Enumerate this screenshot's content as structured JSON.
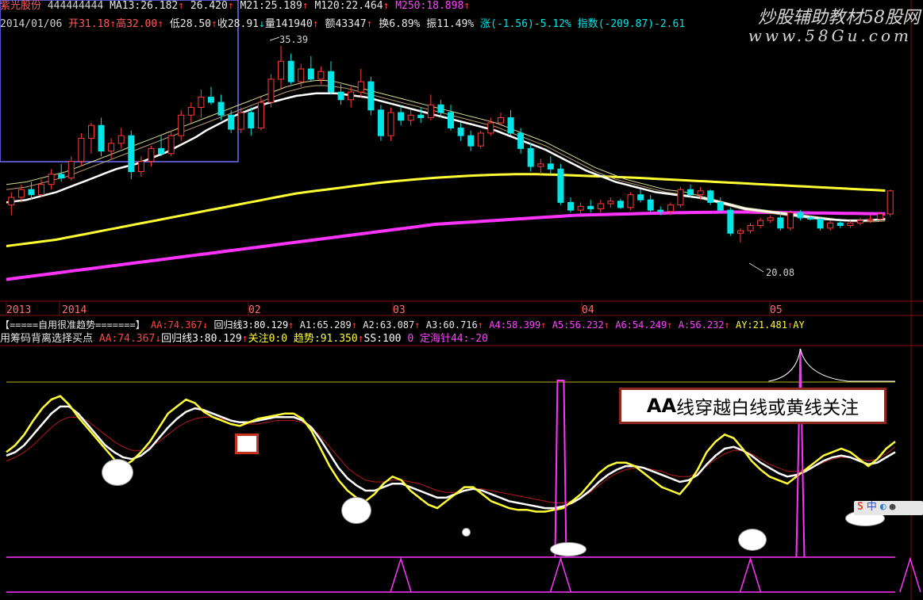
{
  "stock": {
    "name": "紫光股份",
    "code": "444444444",
    "ma13": "MA13:26.182",
    "ma13_val": "26.420",
    "ma21": "M21:25.189",
    "ma120": "M120:22.464",
    "ma250": "M250:18.898"
  },
  "info": {
    "date": "2014/01/06",
    "open": "开31.18",
    "high": "高32.00",
    "low": "低28.50",
    "close": "收28.91",
    "volume": "量141940",
    "amount": "额43347",
    "turnover": "换6.89%",
    "amplitude": "振11.49%",
    "change": "涨(-1.56)-5.12%",
    "index": "指数(-209.87)-2.61"
  },
  "watermark": {
    "line1": "炒股辅助教材58股网",
    "line2": "www.58Gu.com"
  },
  "labels": {
    "high_label": "35.39",
    "low_label": "20.08"
  },
  "time_axis": [
    "2013",
    "2014",
    "02",
    "03",
    "04",
    "05"
  ],
  "indicator1": {
    "name": "【=====自用很准趋势=======】",
    "aa": "AA:74.367",
    "huigui": "回归线3:80.129",
    "a1": "A1:65.289",
    "a2": "A2:63.087",
    "a3": "A3:60.716",
    "a4": "A4:58.399",
    "a5": "A5:56.232",
    "a6": "A6:54.249",
    "a": "A:56.232",
    "ay": "AY:21.481",
    "ay_tail": "AY"
  },
  "indicator2": {
    "name": "用筹码背离选择买点",
    "aa": "AA:74.367",
    "huigui": "回归线3:80.129",
    "guanzhu": "关注0:0",
    "qushi": "趋势:91.350",
    "ss": "SS:100",
    "zero": "0",
    "dinghai": "定海针44:-20"
  },
  "annotation": {
    "bold": "AA",
    "text": "线穿越白线或黄线关注"
  },
  "colors": {
    "up": "#ff3b3b",
    "down": "#00e5e5",
    "ma_white": "#ffffff",
    "ma_yellow": "#ffff33",
    "ma_magenta": "#ff33ff",
    "ma_thin": "#d8d890",
    "frame": "#7a0e0e"
  },
  "chart_data": {
    "type": "candlestick",
    "x_labels": [
      "2013",
      "2014",
      "02",
      "03",
      "04",
      "05"
    ],
    "candles": [
      {
        "o": 23.0,
        "h": 24.0,
        "l": 22.2,
        "c": 23.6
      },
      {
        "o": 23.6,
        "h": 24.6,
        "l": 23.2,
        "c": 24.2
      },
      {
        "o": 24.2,
        "h": 24.8,
        "l": 23.4,
        "c": 23.8
      },
      {
        "o": 23.8,
        "h": 25.0,
        "l": 23.6,
        "c": 24.6
      },
      {
        "o": 24.6,
        "h": 25.8,
        "l": 24.2,
        "c": 25.4
      },
      {
        "o": 25.4,
        "h": 26.2,
        "l": 24.8,
        "c": 25.1
      },
      {
        "o": 25.1,
        "h": 26.8,
        "l": 24.9,
        "c": 26.4
      },
      {
        "o": 26.4,
        "h": 28.6,
        "l": 26.0,
        "c": 28.2
      },
      {
        "o": 28.2,
        "h": 29.4,
        "l": 27.0,
        "c": 29.2
      },
      {
        "o": 29.2,
        "h": 29.8,
        "l": 26.8,
        "c": 27.2
      },
      {
        "o": 27.2,
        "h": 28.2,
        "l": 26.6,
        "c": 27.8
      },
      {
        "o": 27.8,
        "h": 29.0,
        "l": 27.4,
        "c": 28.4
      },
      {
        "o": 28.4,
        "h": 28.8,
        "l": 25.0,
        "c": 25.6
      },
      {
        "o": 25.6,
        "h": 26.8,
        "l": 25.2,
        "c": 26.4
      },
      {
        "o": 26.4,
        "h": 27.6,
        "l": 26.0,
        "c": 27.4
      },
      {
        "o": 27.4,
        "h": 28.4,
        "l": 26.8,
        "c": 27.0
      },
      {
        "o": 27.0,
        "h": 28.8,
        "l": 26.8,
        "c": 28.4
      },
      {
        "o": 28.4,
        "h": 30.4,
        "l": 28.0,
        "c": 30.0
      },
      {
        "o": 30.0,
        "h": 31.0,
        "l": 29.4,
        "c": 30.6
      },
      {
        "o": 30.6,
        "h": 32.0,
        "l": 29.8,
        "c": 31.4
      },
      {
        "o": 31.4,
        "h": 32.2,
        "l": 30.8,
        "c": 31.0
      },
      {
        "o": 31.0,
        "h": 31.6,
        "l": 29.6,
        "c": 30.0
      },
      {
        "o": 30.0,
        "h": 30.4,
        "l": 28.6,
        "c": 28.9
      },
      {
        "o": 28.9,
        "h": 30.6,
        "l": 28.6,
        "c": 30.2
      },
      {
        "o": 30.2,
        "h": 30.6,
        "l": 28.4,
        "c": 29.0
      },
      {
        "o": 29.0,
        "h": 31.4,
        "l": 28.8,
        "c": 31.0
      },
      {
        "o": 31.0,
        "h": 33.2,
        "l": 30.6,
        "c": 32.8
      },
      {
        "o": 32.8,
        "h": 35.39,
        "l": 32.0,
        "c": 34.2
      },
      {
        "o": 34.2,
        "h": 34.8,
        "l": 32.4,
        "c": 32.6
      },
      {
        "o": 32.6,
        "h": 34.0,
        "l": 32.2,
        "c": 33.6
      },
      {
        "o": 33.6,
        "h": 34.6,
        "l": 32.6,
        "c": 32.8
      },
      {
        "o": 32.8,
        "h": 33.8,
        "l": 32.4,
        "c": 33.4
      },
      {
        "o": 33.4,
        "h": 34.2,
        "l": 31.6,
        "c": 31.8
      },
      {
        "o": 31.8,
        "h": 32.4,
        "l": 30.8,
        "c": 31.2
      },
      {
        "o": 31.2,
        "h": 32.2,
        "l": 30.6,
        "c": 31.8
      },
      {
        "o": 31.8,
        "h": 33.6,
        "l": 31.4,
        "c": 32.6
      },
      {
        "o": 32.6,
        "h": 33.0,
        "l": 30.0,
        "c": 30.4
      },
      {
        "o": 30.4,
        "h": 30.8,
        "l": 28.0,
        "c": 28.4
      },
      {
        "o": 28.4,
        "h": 30.6,
        "l": 28.0,
        "c": 30.2
      },
      {
        "o": 30.2,
        "h": 30.8,
        "l": 29.2,
        "c": 29.6
      },
      {
        "o": 29.6,
        "h": 30.4,
        "l": 29.2,
        "c": 30.0
      },
      {
        "o": 30.0,
        "h": 30.6,
        "l": 29.4,
        "c": 29.8
      },
      {
        "o": 29.8,
        "h": 31.6,
        "l": 29.6,
        "c": 30.8
      },
      {
        "o": 30.8,
        "h": 31.2,
        "l": 29.8,
        "c": 30.2
      },
      {
        "o": 30.2,
        "h": 30.8,
        "l": 28.8,
        "c": 29.0
      },
      {
        "o": 29.0,
        "h": 29.4,
        "l": 28.0,
        "c": 28.4
      },
      {
        "o": 28.4,
        "h": 28.8,
        "l": 27.2,
        "c": 27.6
      },
      {
        "o": 27.6,
        "h": 28.8,
        "l": 27.4,
        "c": 28.6
      },
      {
        "o": 28.6,
        "h": 29.8,
        "l": 28.4,
        "c": 29.4
      },
      {
        "o": 29.4,
        "h": 30.2,
        "l": 29.2,
        "c": 29.8
      },
      {
        "o": 29.8,
        "h": 30.4,
        "l": 28.4,
        "c": 28.6
      },
      {
        "o": 28.6,
        "h": 29.0,
        "l": 27.0,
        "c": 27.4
      },
      {
        "o": 27.4,
        "h": 27.8,
        "l": 25.6,
        "c": 26.0
      },
      {
        "o": 26.0,
        "h": 26.6,
        "l": 25.4,
        "c": 26.2
      },
      {
        "o": 26.2,
        "h": 26.8,
        "l": 25.4,
        "c": 25.8
      },
      {
        "o": 25.8,
        "h": 26.2,
        "l": 23.0,
        "c": 23.2
      },
      {
        "o": 23.2,
        "h": 23.6,
        "l": 22.4,
        "c": 22.6
      },
      {
        "o": 22.6,
        "h": 23.2,
        "l": 22.2,
        "c": 22.9
      },
      {
        "o": 22.9,
        "h": 23.4,
        "l": 22.4,
        "c": 22.7
      },
      {
        "o": 22.7,
        "h": 23.4,
        "l": 22.4,
        "c": 23.1
      },
      {
        "o": 23.1,
        "h": 23.6,
        "l": 22.8,
        "c": 23.3
      },
      {
        "o": 23.3,
        "h": 23.5,
        "l": 22.7,
        "c": 22.8
      },
      {
        "o": 22.8,
        "h": 24.0,
        "l": 22.6,
        "c": 23.8
      },
      {
        "o": 23.8,
        "h": 24.2,
        "l": 23.2,
        "c": 23.4
      },
      {
        "o": 23.4,
        "h": 23.8,
        "l": 22.4,
        "c": 22.6
      },
      {
        "o": 22.6,
        "h": 22.9,
        "l": 22.2,
        "c": 22.5
      },
      {
        "o": 22.5,
        "h": 23.2,
        "l": 22.2,
        "c": 23.0
      },
      {
        "o": 23.0,
        "h": 24.4,
        "l": 22.8,
        "c": 24.2
      },
      {
        "o": 24.2,
        "h": 24.6,
        "l": 23.6,
        "c": 23.8
      },
      {
        "o": 23.8,
        "h": 24.4,
        "l": 23.4,
        "c": 24.1
      },
      {
        "o": 24.1,
        "h": 24.2,
        "l": 23.0,
        "c": 23.2
      },
      {
        "o": 23.2,
        "h": 23.6,
        "l": 22.4,
        "c": 22.6
      },
      {
        "o": 22.6,
        "h": 22.8,
        "l": 20.6,
        "c": 20.8
      },
      {
        "o": 20.8,
        "h": 21.2,
        "l": 20.08,
        "c": 21.0
      },
      {
        "o": 21.0,
        "h": 21.6,
        "l": 20.8,
        "c": 21.4
      },
      {
        "o": 21.4,
        "h": 22.0,
        "l": 21.2,
        "c": 21.8
      },
      {
        "o": 21.8,
        "h": 22.2,
        "l": 21.6,
        "c": 22.0
      },
      {
        "o": 22.0,
        "h": 22.4,
        "l": 21.0,
        "c": 21.2
      },
      {
        "o": 21.2,
        "h": 22.6,
        "l": 21.0,
        "c": 22.4
      },
      {
        "o": 22.4,
        "h": 22.6,
        "l": 21.8,
        "c": 22.0
      },
      {
        "o": 22.0,
        "h": 22.2,
        "l": 21.8,
        "c": 21.9
      },
      {
        "o": 21.9,
        "h": 22.0,
        "l": 21.0,
        "c": 21.2
      },
      {
        "o": 21.2,
        "h": 21.8,
        "l": 21.0,
        "c": 21.6
      },
      {
        "o": 21.6,
        "h": 21.8,
        "l": 21.2,
        "c": 21.4
      },
      {
        "o": 21.4,
        "h": 21.8,
        "l": 21.2,
        "c": 21.6
      },
      {
        "o": 21.6,
        "h": 22.0,
        "l": 21.4,
        "c": 21.8
      },
      {
        "o": 21.8,
        "h": 22.2,
        "l": 21.6,
        "c": 21.9
      },
      {
        "o": 21.9,
        "h": 22.4,
        "l": 21.7,
        "c": 22.3
      },
      {
        "o": 22.3,
        "h": 24.2,
        "l": 22.1,
        "c": 24.1
      }
    ],
    "ma_white": [
      23.2,
      23.3,
      23.4,
      23.6,
      23.8,
      24.0,
      24.3,
      24.6,
      24.9,
      25.2,
      25.5,
      25.8,
      26.0,
      26.2,
      26.5,
      26.8,
      27.1,
      27.5,
      27.9,
      28.3,
      28.8,
      29.2,
      29.6,
      30.0,
      30.3,
      30.6,
      30.9,
      31.1,
      31.3,
      31.5,
      31.6,
      31.7,
      31.7,
      31.7,
      31.6,
      31.5,
      31.4,
      31.2,
      31.0,
      30.8,
      30.6,
      30.4,
      30.2,
      30.0,
      29.8,
      29.6,
      29.4,
      29.2,
      29.0,
      28.8,
      28.5,
      28.2,
      27.9,
      27.6,
      27.3,
      26.9,
      26.5,
      26.1,
      25.7,
      25.4,
      25.1,
      24.8,
      24.6,
      24.4,
      24.2,
      24.0,
      23.9,
      23.8,
      23.7,
      23.6,
      23.5,
      23.3,
      23.1,
      22.9,
      22.7,
      22.6,
      22.5,
      22.4,
      22.3,
      22.2,
      22.1,
      22.0,
      21.9,
      21.85,
      21.8,
      21.8,
      21.8,
      21.85,
      21.9
    ],
    "ma_thin1": [
      24.2,
      24.3,
      24.4,
      24.6,
      24.8,
      25.0,
      25.2,
      25.5,
      25.8,
      26.1,
      26.4,
      26.7,
      27.0,
      27.3,
      27.6,
      27.9,
      28.2,
      28.5,
      28.8,
      29.1,
      29.4,
      29.7,
      30.0,
      30.3,
      30.6,
      30.9,
      31.2,
      31.5,
      31.8,
      32.0,
      32.2,
      32.3,
      32.3,
      32.2,
      32.1,
      31.9,
      31.7,
      31.5,
      31.3,
      31.1,
      30.9,
      30.7,
      30.5,
      30.3,
      30.1,
      29.9,
      29.7,
      29.5,
      29.3,
      29.1,
      28.8,
      28.5,
      28.2,
      27.9,
      27.6,
      27.2,
      26.8,
      26.4,
      26.0,
      25.6,
      25.3,
      25.0,
      24.8,
      24.6,
      24.4,
      24.2,
      24.0,
      23.9,
      23.8,
      23.6,
      23.4,
      23.2,
      23.0,
      22.8,
      22.6,
      22.5,
      22.4,
      22.3,
      22.2,
      22.1,
      22.0,
      21.9,
      21.85,
      21.8,
      21.75,
      21.7,
      21.7,
      21.7,
      21.75
    ],
    "ma_thin2": [
      24.6,
      24.7,
      24.8,
      25.0,
      25.2,
      25.4,
      25.6,
      25.9,
      26.2,
      26.5,
      26.8,
      27.1,
      27.4,
      27.7,
      28.0,
      28.3,
      28.6,
      28.9,
      29.2,
      29.5,
      29.8,
      30.1,
      30.4,
      30.7,
      31.0,
      31.3,
      31.6,
      31.9,
      32.2,
      32.4,
      32.6,
      32.7,
      32.7,
      32.6,
      32.4,
      32.2,
      32.0,
      31.8,
      31.6,
      31.4,
      31.2,
      31.0,
      30.8,
      30.6,
      30.4,
      30.2,
      30.0,
      29.8,
      29.6,
      29.4,
      29.1,
      28.8,
      28.5,
      28.2,
      27.9,
      27.5,
      27.1,
      26.7,
      26.3,
      25.9,
      25.6,
      25.3,
      25.0,
      24.8,
      24.6,
      24.4,
      24.2,
      24.1,
      24.0,
      23.8,
      23.6,
      23.4,
      23.2,
      23.0,
      22.8,
      22.7,
      22.6,
      22.5,
      22.4,
      22.3,
      22.2,
      22.1,
      22.0,
      21.9,
      21.85,
      21.8,
      21.8,
      21.8,
      21.85
    ],
    "ma_yellow": [
      19.8,
      19.9,
      20.0,
      20.1,
      20.2,
      20.3,
      20.45,
      20.6,
      20.75,
      20.9,
      21.05,
      21.2,
      21.35,
      21.5,
      21.65,
      21.8,
      21.95,
      22.1,
      22.25,
      22.4,
      22.55,
      22.7,
      22.85,
      23.0,
      23.15,
      23.3,
      23.45,
      23.6,
      23.75,
      23.9,
      24.0,
      24.1,
      24.2,
      24.3,
      24.4,
      24.5,
      24.6,
      24.7,
      24.78,
      24.86,
      24.93,
      25.0,
      25.06,
      25.12,
      25.17,
      25.22,
      25.26,
      25.3,
      25.33,
      25.36,
      25.38,
      25.4,
      25.4,
      25.4,
      25.38,
      25.36,
      25.33,
      25.3,
      25.27,
      25.24,
      25.21,
      25.18,
      25.15,
      25.12,
      25.08,
      25.04,
      25.0,
      24.96,
      24.92,
      24.88,
      24.84,
      24.8,
      24.76,
      24.72,
      24.68,
      24.64,
      24.6,
      24.56,
      24.52,
      24.48,
      24.44,
      24.4,
      24.36,
      24.32,
      24.28,
      24.24,
      24.2,
      24.16,
      24.12
    ],
    "ma_magenta": [
      17.2,
      17.3,
      17.4,
      17.5,
      17.6,
      17.7,
      17.8,
      17.9,
      18.0,
      18.1,
      18.2,
      18.3,
      18.4,
      18.5,
      18.6,
      18.7,
      18.8,
      18.9,
      19.0,
      19.1,
      19.2,
      19.3,
      19.4,
      19.5,
      19.6,
      19.7,
      19.8,
      19.9,
      20.0,
      20.1,
      20.2,
      20.3,
      20.4,
      20.5,
      20.6,
      20.7,
      20.8,
      20.9,
      21.0,
      21.1,
      21.2,
      21.3,
      21.4,
      21.5,
      21.55,
      21.6,
      21.65,
      21.7,
      21.75,
      21.8,
      21.85,
      21.9,
      21.95,
      22.0,
      22.05,
      22.1,
      22.15,
      22.2,
      22.22,
      22.24,
      22.26,
      22.28,
      22.3,
      22.32,
      22.34,
      22.36,
      22.38,
      22.4,
      22.41,
      22.42,
      22.43,
      22.44,
      22.45,
      22.45,
      22.45,
      22.44,
      22.43,
      22.42,
      22.41,
      22.4,
      22.39,
      22.38,
      22.37,
      22.36,
      22.35,
      22.34,
      22.33,
      22.32,
      22.31
    ],
    "osc_yellow": [
      60,
      64,
      70,
      78,
      85,
      90,
      92,
      87,
      80,
      74,
      68,
      62,
      56,
      52,
      55,
      60,
      66,
      74,
      82,
      86,
      90,
      88,
      83,
      80,
      78,
      76,
      75,
      77,
      79,
      80,
      81,
      82,
      82,
      79,
      72,
      62,
      52,
      44,
      38,
      34,
      32,
      36,
      42,
      46,
      44,
      38,
      34,
      30,
      28,
      32,
      36,
      40,
      40,
      36,
      32,
      30,
      28,
      27,
      27,
      26,
      26,
      27,
      28,
      32,
      36,
      42,
      48,
      52,
      54,
      54,
      52,
      48,
      44,
      40,
      38,
      36,
      42,
      50,
      60,
      66,
      70,
      68,
      62,
      55,
      50,
      46,
      44,
      42,
      46,
      50,
      54,
      58,
      60,
      62,
      60,
      56,
      52,
      56,
      62,
      66
    ],
    "osc_white": [
      58,
      60,
      64,
      70,
      76,
      82,
      86,
      86,
      82,
      76,
      70,
      64,
      60,
      57,
      56,
      58,
      62,
      68,
      74,
      79,
      83,
      85,
      84,
      82,
      80,
      78,
      77,
      77,
      78,
      79,
      80,
      80,
      80,
      78,
      74,
      67,
      59,
      51,
      45,
      41,
      38,
      38,
      40,
      42,
      42,
      40,
      38,
      36,
      34,
      34,
      36,
      38,
      39,
      38,
      36,
      34,
      32,
      31,
      30,
      29,
      28,
      28,
      29,
      31,
      34,
      38,
      43,
      47,
      50,
      52,
      52,
      51,
      49,
      47,
      45,
      43,
      44,
      47,
      53,
      58,
      62,
      63,
      61,
      58,
      54,
      51,
      48,
      46,
      47,
      49,
      52,
      55,
      57,
      58,
      57,
      55,
      53,
      54,
      57,
      60
    ],
    "osc_red": [
      55,
      57,
      60,
      64,
      69,
      74,
      78,
      80,
      80,
      78,
      74,
      70,
      66,
      63,
      61,
      61,
      63,
      66,
      70,
      74,
      77,
      79,
      80,
      80,
      79,
      78,
      77,
      76,
      76,
      77,
      78,
      78,
      78,
      77,
      74,
      69,
      63,
      57,
      51,
      47,
      44,
      43,
      43,
      44,
      44,
      43,
      42,
      40,
      38,
      37,
      37,
      38,
      39,
      39,
      38,
      37,
      36,
      35,
      34,
      33,
      32,
      31,
      31,
      32,
      34,
      37,
      41,
      45,
      48,
      50,
      51,
      51,
      50,
      49,
      47,
      46,
      46,
      48,
      52,
      56,
      59,
      61,
      61,
      59,
      56,
      53,
      51,
      49,
      49,
      50,
      52,
      54,
      56,
      57,
      57,
      56,
      55,
      56,
      59,
      63
    ],
    "ss_spikes": [
      55,
      79
    ],
    "bottom_spikes": [
      39,
      55,
      74,
      90
    ]
  }
}
